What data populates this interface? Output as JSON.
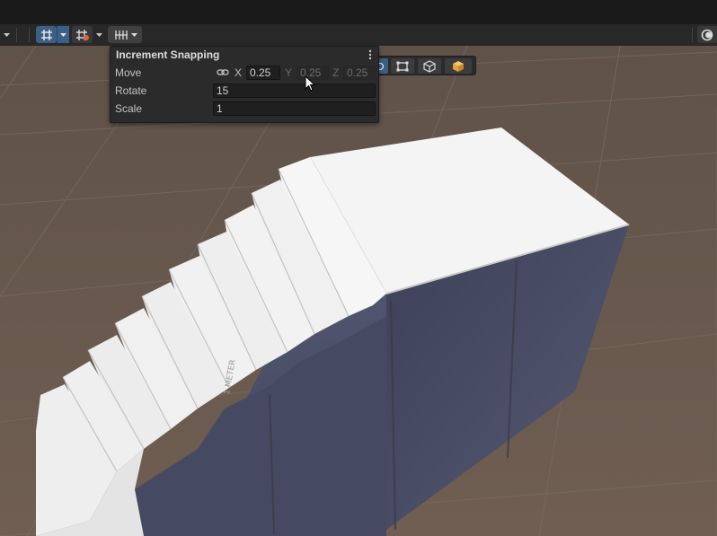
{
  "toolbar": {
    "grid_snapping_icon": "grid-snap-icon",
    "snap_to_grid_icon": "snap-to-grid-icon",
    "increment_snap_icon": "increment-snap-icon",
    "active_color": "#3b5f86"
  },
  "increment_snapping": {
    "title": "Increment Snapping",
    "rows": {
      "move": {
        "label": "Move",
        "x_label": "X",
        "x_value": "0.25",
        "y_label": "Y",
        "y_value": "0.25",
        "z_label": "Z",
        "z_value": "0.25"
      },
      "rotate": {
        "label": "Rotate",
        "value": "15"
      },
      "scale": {
        "label": "Scale",
        "value": "1"
      }
    }
  },
  "scene": {
    "ground_color": "#6a5a4e",
    "grid_color": "#7d6e62",
    "box_top_color": "#f3f3f3",
    "box_side_color": "#4a4e66",
    "measure_label": "1 METER"
  }
}
